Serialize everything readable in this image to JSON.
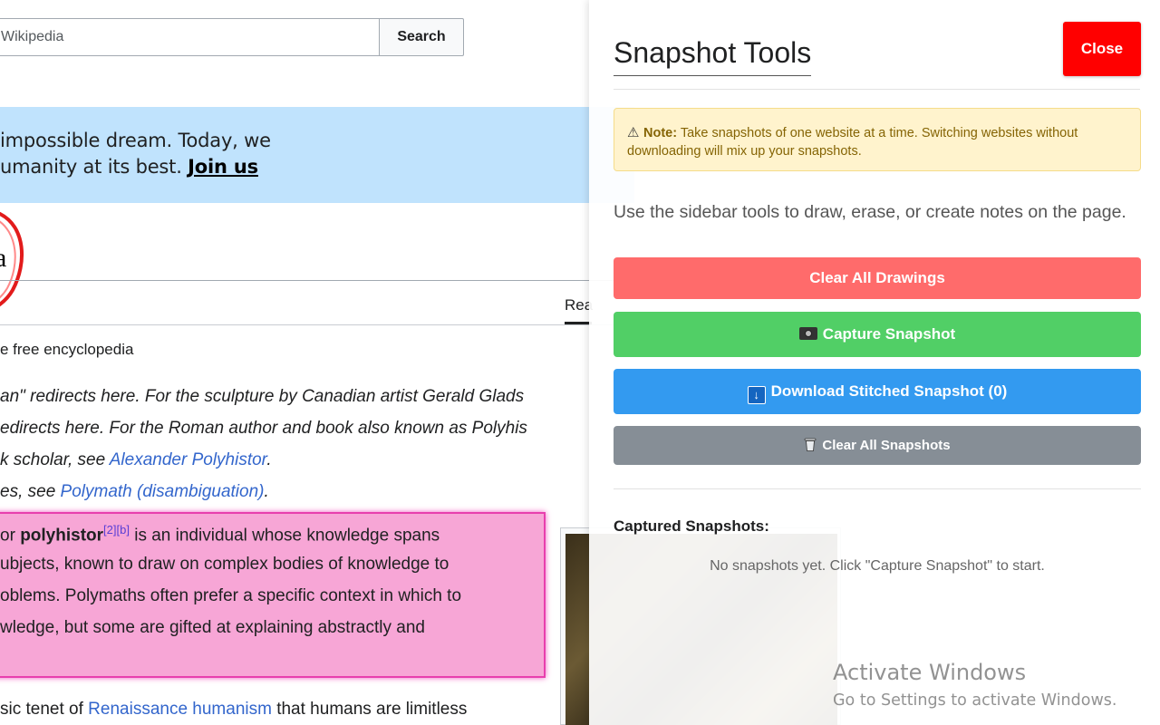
{
  "wiki": {
    "search_placeholder": "Wikipedia",
    "search_button": "Search",
    "banner_line1": " impossible dream. Today, we",
    "banner_line2": "umanity at its best. ",
    "banner_link": "Join us",
    "title_fragment": "a",
    "read_tab": "Rea",
    "from_text": "e free encyclopedia",
    "hatnote1": "an\" redirects here. For the sculpture by Canadian artist Gerald Glads",
    "hatnote2": "edirects here. For the Roman author and book also known as Polyhis",
    "hatnote3_prefix": "k scholar, see ",
    "hatnote3_link": "Alexander Polyhistor",
    "hatnote3_suffix": ".",
    "hatnote4_prefix": "es, see ",
    "hatnote4_link": "Polymath (disambiguation)",
    "hatnote4_suffix": ".",
    "lead1_prefix": "or ",
    "lead1_bold": "polyhistor",
    "lead1_sup": "[2][b]",
    "lead1_suffix": " is an individual whose knowledge spans",
    "lead2": "ubjects, known to draw on complex bodies of knowledge to",
    "lead3": "oblems. Polymaths often prefer a specific context in which to",
    "lead4": "wledge, but some are gifted at explaining abstractly and",
    "last_prefix": "sic tenet of ",
    "last_link": "Renaissance humanism",
    "last_suffix": " that humans are limitless"
  },
  "panel": {
    "title": "Snapshot Tools",
    "close_label": "Close",
    "note_label": "Note:",
    "note_text": " Take snapshots of one website at a time. Switching websites without downloading will mix up your snapshots.",
    "instructions": "Use the sidebar tools to draw, erase, or create notes on the page.",
    "clear_drawings_label": "Clear All Drawings",
    "capture_label": "Capture Snapshot",
    "download_label": "Download Stitched Snapshot (0)",
    "clear_snapshots_label": "Clear All Snapshots",
    "captured_title": "Captured Snapshots:",
    "empty_message": "No snapshots yet. Click \"Capture Snapshot\" to start."
  },
  "watermark": {
    "title": "Activate Windows",
    "subtitle": "Go to Settings to activate Windows."
  },
  "colors": {
    "close": "#ff0000",
    "clear_drawings": "#ff6b6b",
    "capture": "#51cf66",
    "download": "#339af0",
    "clear_snapshots": "#868e96",
    "note_bg": "#fff3cd",
    "highlight": "#f7a6d6"
  }
}
